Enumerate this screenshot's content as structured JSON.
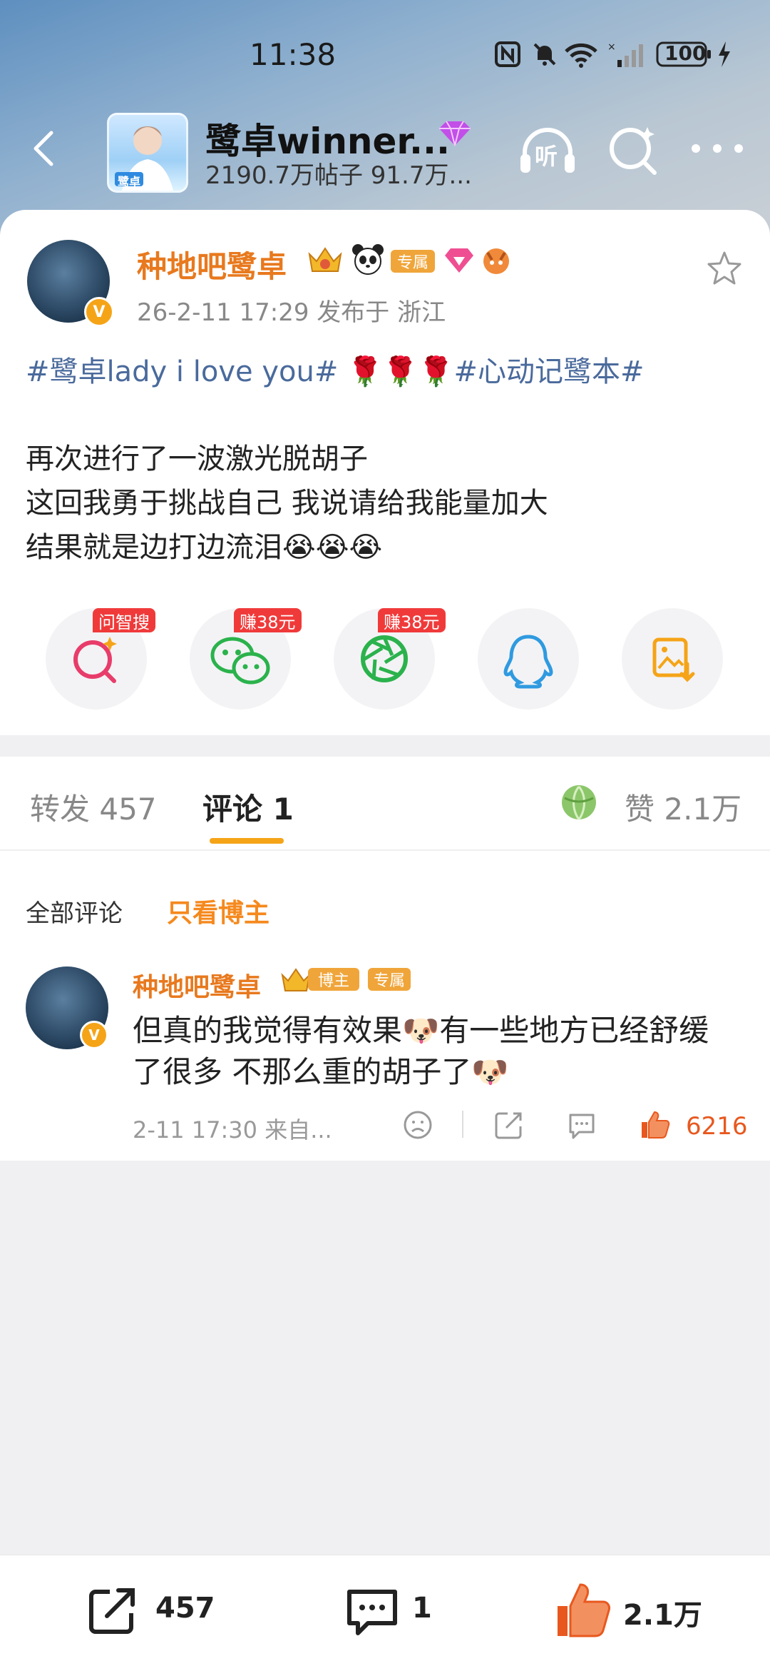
{
  "status_bar": {
    "time": "11:38",
    "battery": "100"
  },
  "header": {
    "title": "鹭卓winner...",
    "subtitle": "2190.7万帖子 91.7万...",
    "listen_label": "听",
    "avatar_caption": "鹭卓"
  },
  "post": {
    "author": "种地吧鹭卓",
    "badge_exclusive": "专属",
    "meta": "26-2-11 17:29  发布于 浙江",
    "tags": "#鹭卓lady i love you# 🌹🌹🌹#心动记鹭本#",
    "lines": [
      "再次进行了一波激光脱胡子",
      "这回我勇于挑战自己 我说请给我能量加大",
      "结果就是边打边流泪😭😭😭"
    ]
  },
  "share": {
    "wenzhisou_tag": "问智搜",
    "wechat_tag": "赚38元",
    "moments_tag": "赚38元"
  },
  "tabs": {
    "repost": "转发 457",
    "comment": "评论 1",
    "like": "赞 2.1万"
  },
  "comment_filters": {
    "all": "全部评论",
    "blogger_only": "只看博主"
  },
  "comment": {
    "author": "种地吧鹭卓",
    "blogger_tag": "博主",
    "exclusive_tag": "专属",
    "line1": "但真的我觉得有效果🐶有一些地方已经舒缓",
    "line2": "了很多 不那么重的胡子了🐶",
    "meta": "2-11 17:30  来自...",
    "likes": "6216"
  },
  "bottom_bar": {
    "repost_count": "457",
    "comment_count": "1",
    "like_count": "2.1万"
  },
  "colors": {
    "accent_orange": "#f5a418",
    "name_orange": "#e8791e",
    "tag_blue": "#4a6a9c"
  }
}
